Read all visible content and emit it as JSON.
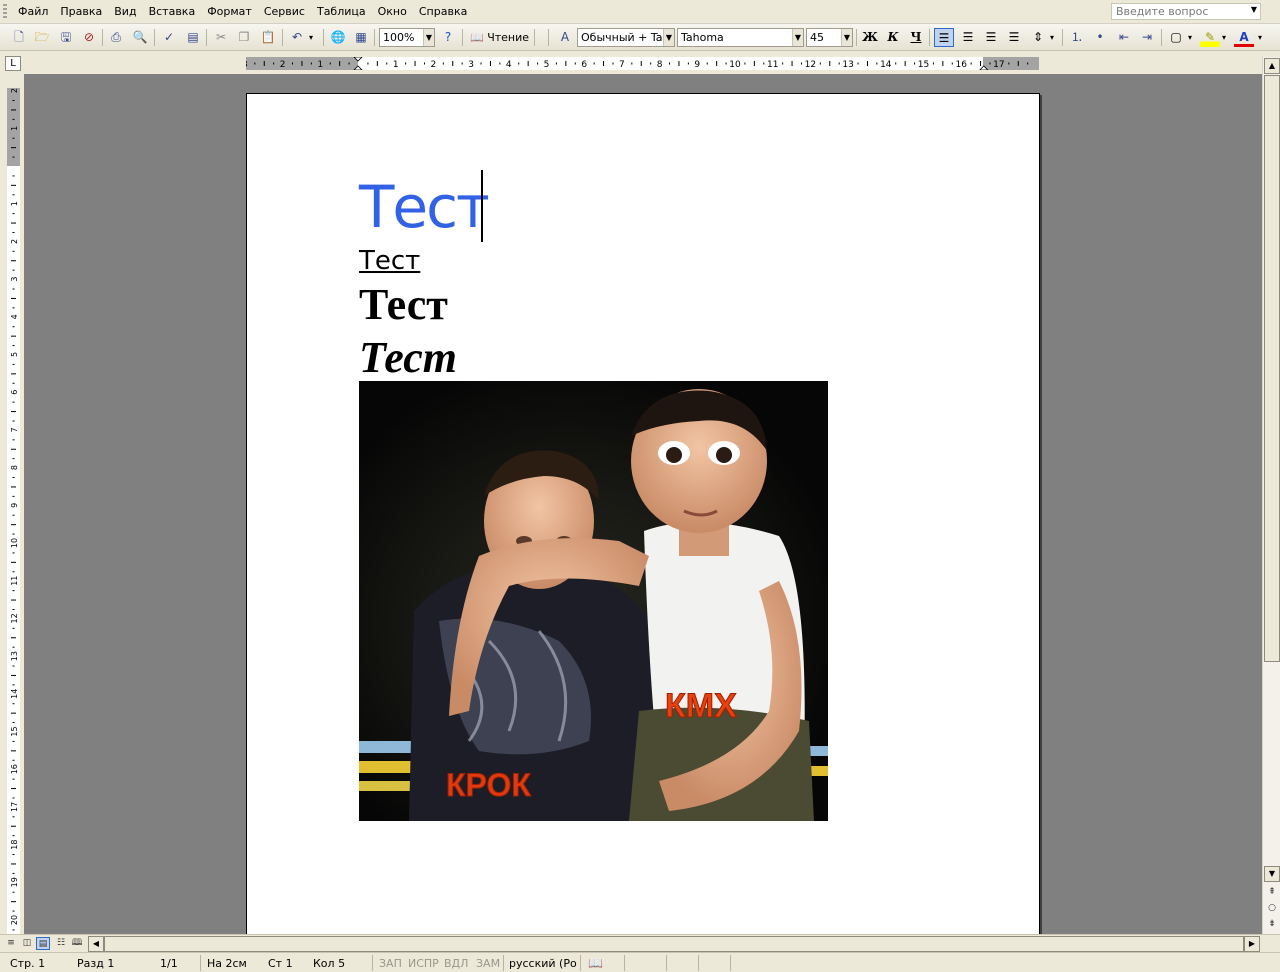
{
  "menu": [
    "Файл",
    "Правка",
    "Вид",
    "Вставка",
    "Формат",
    "Сервис",
    "Таблица",
    "Окно",
    "Справка"
  ],
  "help_search": {
    "placeholder": "Введите вопрос"
  },
  "toolbar": {
    "zoom": "100%",
    "reading_label": "Чтение",
    "style": "Обычный + Tah",
    "font": "Tahoma",
    "size": "45",
    "bold": "Ж",
    "italic": "К",
    "underline": "Ч"
  },
  "ruler": {
    "h_labels": [
      "3",
      "2",
      "1",
      "1",
      "2",
      "3",
      "4",
      "5",
      "6",
      "7",
      "8",
      "9",
      "10",
      "11",
      "12",
      "13",
      "14",
      "15",
      "16",
      "17"
    ],
    "v_labels": [
      "2",
      "1",
      "1",
      "2",
      "3",
      "4",
      "5",
      "6",
      "7",
      "8",
      "9",
      "10",
      "11",
      "12",
      "13",
      "14",
      "15",
      "16",
      "17",
      "18",
      "19",
      "20"
    ],
    "tab_selector": "L"
  },
  "document": {
    "line1": "Тест",
    "line2": "Тест",
    "line3": "Тест",
    "line4": "Тест",
    "photo_caption_right": "КМХ",
    "photo_caption_left": "КРОК"
  },
  "status": {
    "page": "Стр. 1",
    "section": "Разд 1",
    "pages": "1/1",
    "at": "На 2см",
    "line": "Ст 1",
    "col": "Кол 5",
    "rec": "ЗАП",
    "trk": "ИСПР",
    "ext": "ВДЛ",
    "ovr": "ЗАМ",
    "lang": "русский (Ро"
  },
  "colors": {
    "heading_blue": "#3162e6",
    "canvas_gray": "#808080",
    "chrome": "#ece9d8",
    "caption_orange": "#e8400e"
  },
  "icons": [
    "new-icon",
    "open-icon",
    "save-icon",
    "permission-icon",
    "print-icon",
    "print-preview-icon",
    "spelling-icon",
    "research-icon",
    "cut-icon",
    "copy-icon",
    "paste-icon",
    "undo-icon",
    "hyperlink-icon",
    "table-icon",
    "help-icon",
    "styles-icon",
    "align-left-icon",
    "align-center-icon",
    "align-right-icon",
    "justify-icon",
    "line-spacing-icon",
    "numbering-icon",
    "bullets-icon",
    "decrease-indent-icon",
    "increase-indent-icon",
    "border-icon",
    "highlight-icon",
    "font-color-icon"
  ]
}
